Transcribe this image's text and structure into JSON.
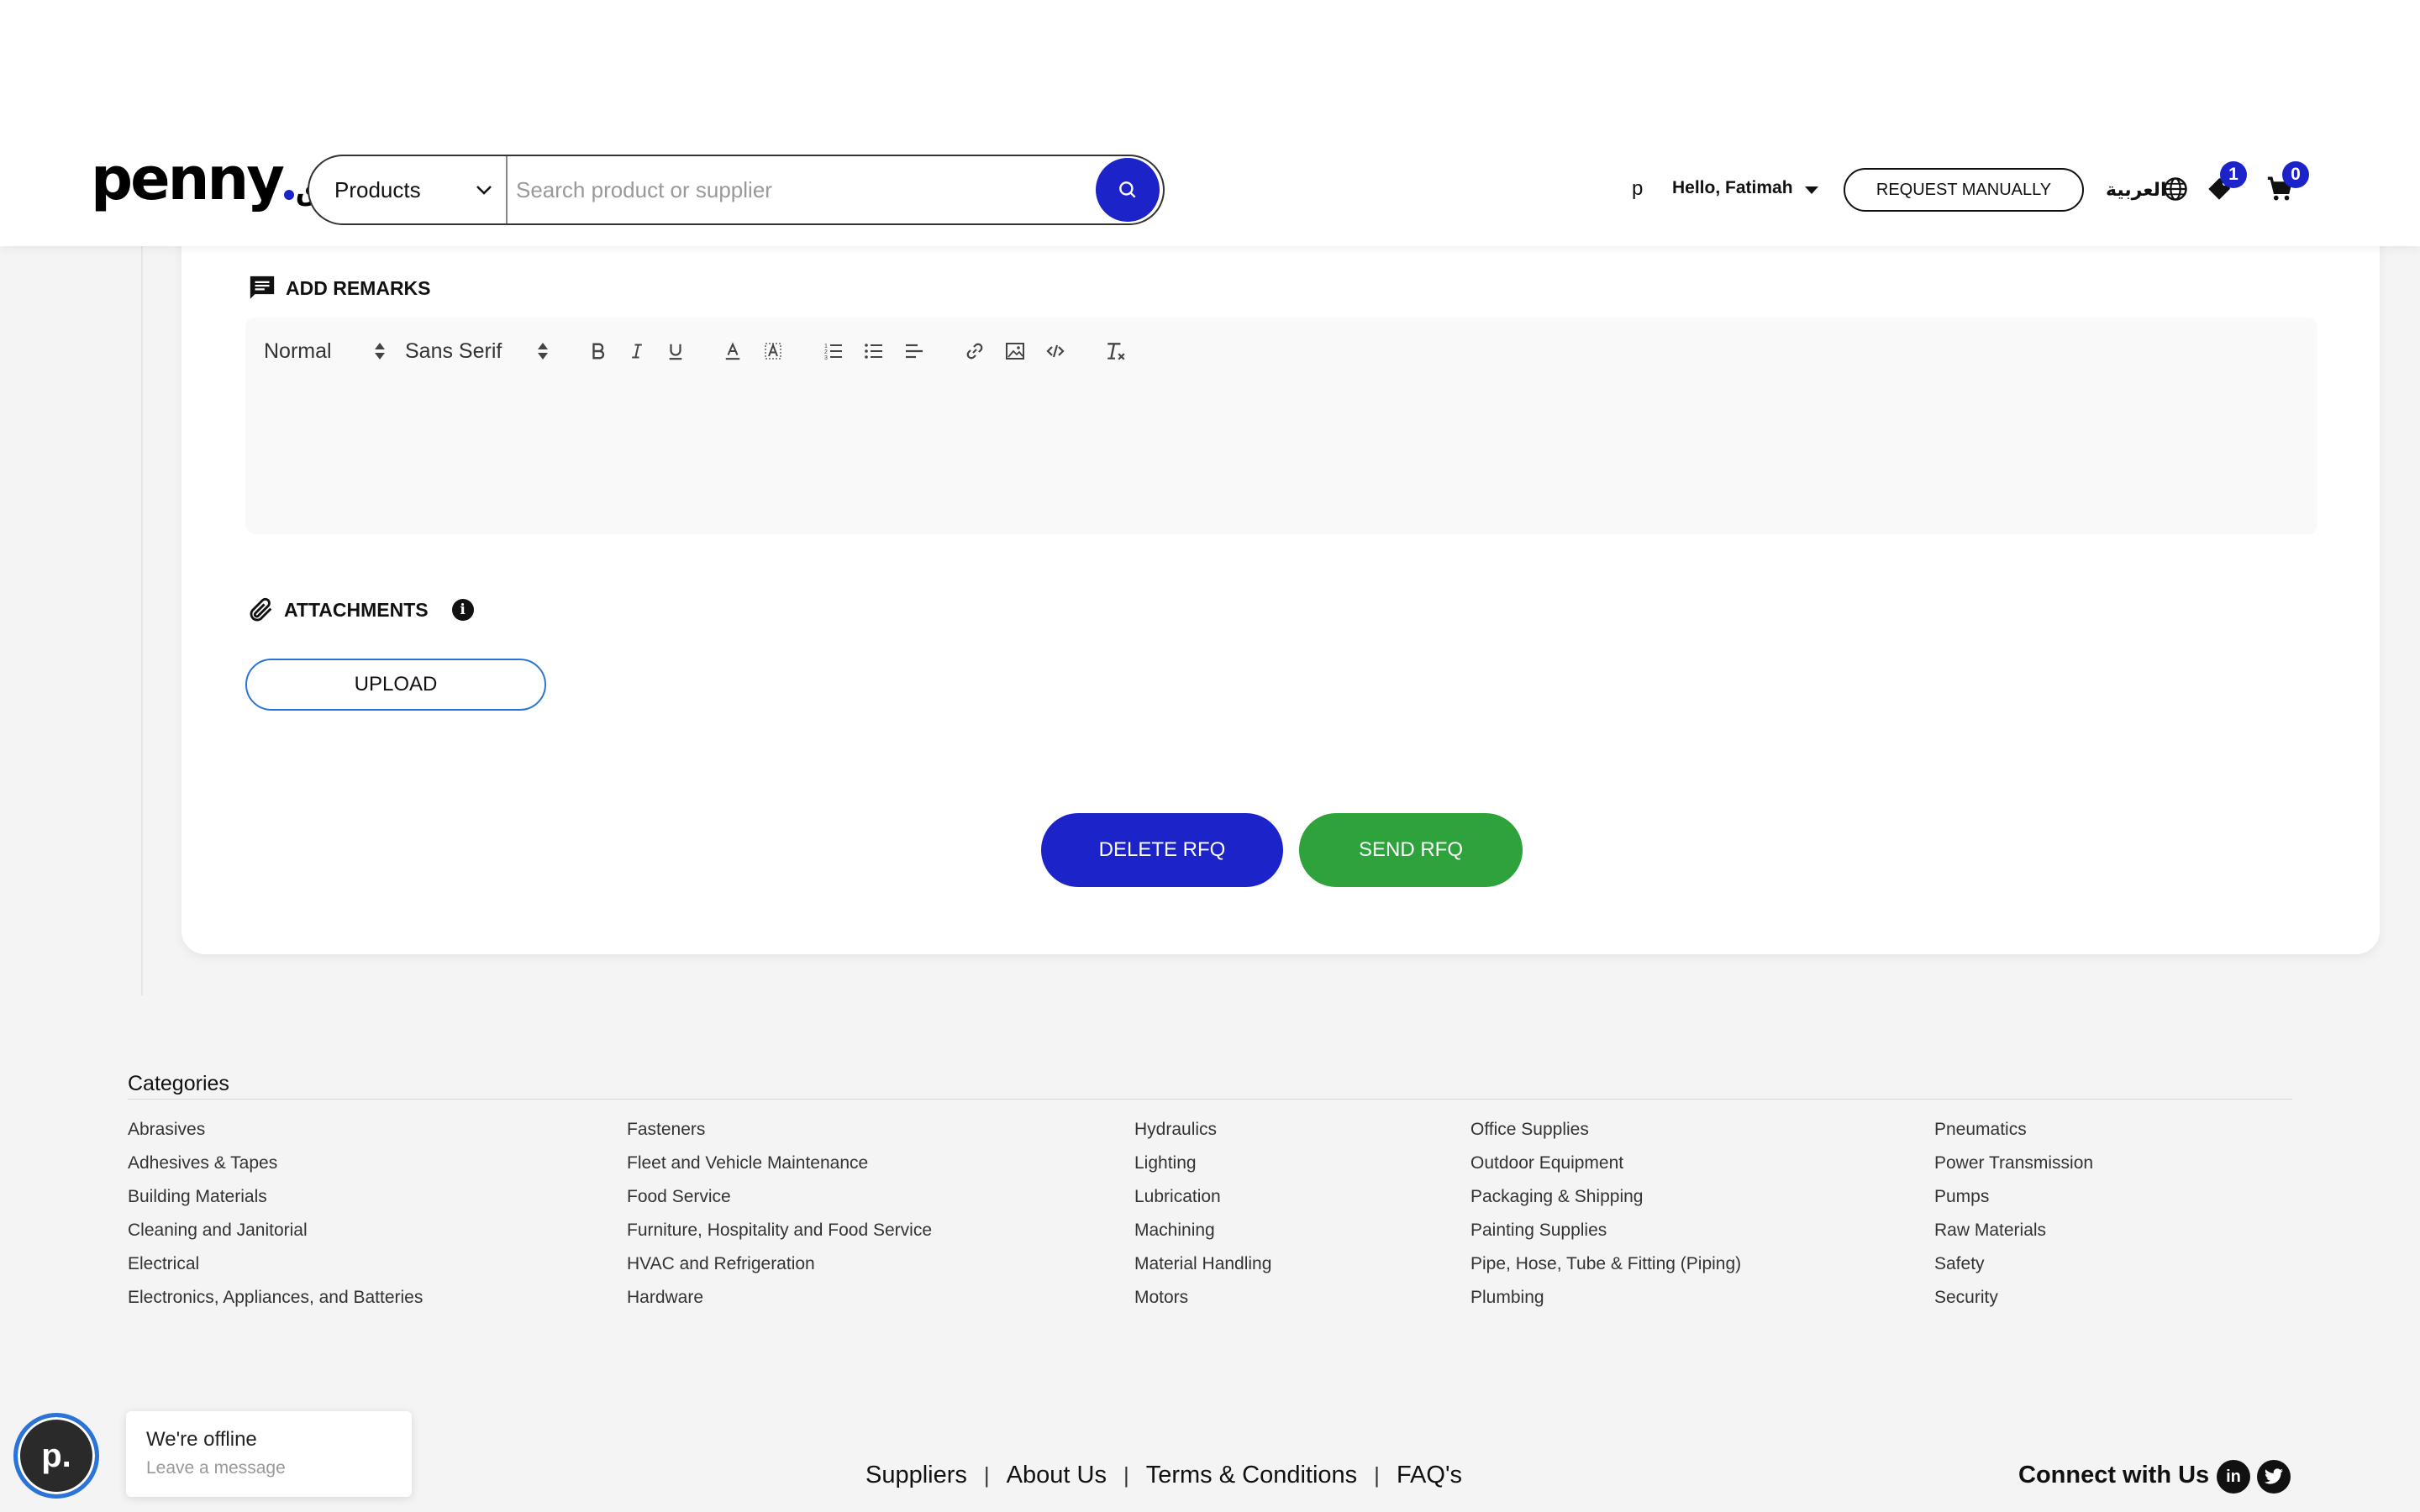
{
  "header": {
    "logo": {
      "word": "penny",
      "arabic": "سوق"
    },
    "search": {
      "category": "Products",
      "placeholder": "Search product or supplier"
    },
    "user_initial": "p",
    "greeting": "Hello, Fatimah",
    "request_button": "REQUEST MANUALLY",
    "language": "العربية",
    "wishlist_count": "1",
    "cart_count": "0"
  },
  "remarks": {
    "title": "ADD REMARKS",
    "toolbar": {
      "heading_select": "Normal",
      "font_select": "Sans Serif",
      "buttons": [
        "bold-icon",
        "italic-icon",
        "underline-icon",
        "font-color-icon",
        "highlight-icon",
        "ordered-list-icon",
        "bullet-list-icon",
        "align-icon",
        "link-icon",
        "image-icon",
        "code-icon",
        "clear-format-icon"
      ]
    }
  },
  "attachments": {
    "title": "ATTACHMENTS",
    "upload_label": "UPLOAD"
  },
  "actions": {
    "delete_label": "DELETE RFQ",
    "send_label": "SEND RFQ"
  },
  "footer": {
    "categories_heading": "Categories",
    "columns": [
      [
        "Abrasives",
        "Adhesives & Tapes",
        "Building Materials",
        "Cleaning and Janitorial",
        "Electrical",
        "Electronics, Appliances, and Batteries"
      ],
      [
        "Fasteners",
        "Fleet and Vehicle Maintenance",
        "Food Service",
        "Furniture, Hospitality and Food Service",
        "HVAC and Refrigeration",
        "Hardware"
      ],
      [
        "Hydraulics",
        "Lighting",
        "Lubrication",
        "Machining",
        "Material Handling",
        "Motors"
      ],
      [
        "Office Supplies",
        "Outdoor Equipment",
        "Packaging & Shipping",
        "Painting Supplies",
        "Pipe, Hose, Tube & Fitting (Piping)",
        "Plumbing"
      ],
      [
        "Pneumatics",
        "Power Transmission",
        "Pumps",
        "Raw Materials",
        "Safety",
        "Security"
      ]
    ],
    "links": [
      "Suppliers",
      "About Us",
      "Terms & Conditions",
      "FAQ's"
    ],
    "separator": "|",
    "connect_label": "Connect with Us",
    "social": [
      "linkedin-icon",
      "twitter-icon"
    ]
  },
  "chat": {
    "avatar_letter": "p.",
    "status": "We're offline",
    "prompt": "Leave a message"
  },
  "colors": {
    "brand_blue": "#1c24c9",
    "send_green": "#2ea33c",
    "upload_border": "#2a73d9",
    "footer_bg": "#f4f4f4"
  }
}
